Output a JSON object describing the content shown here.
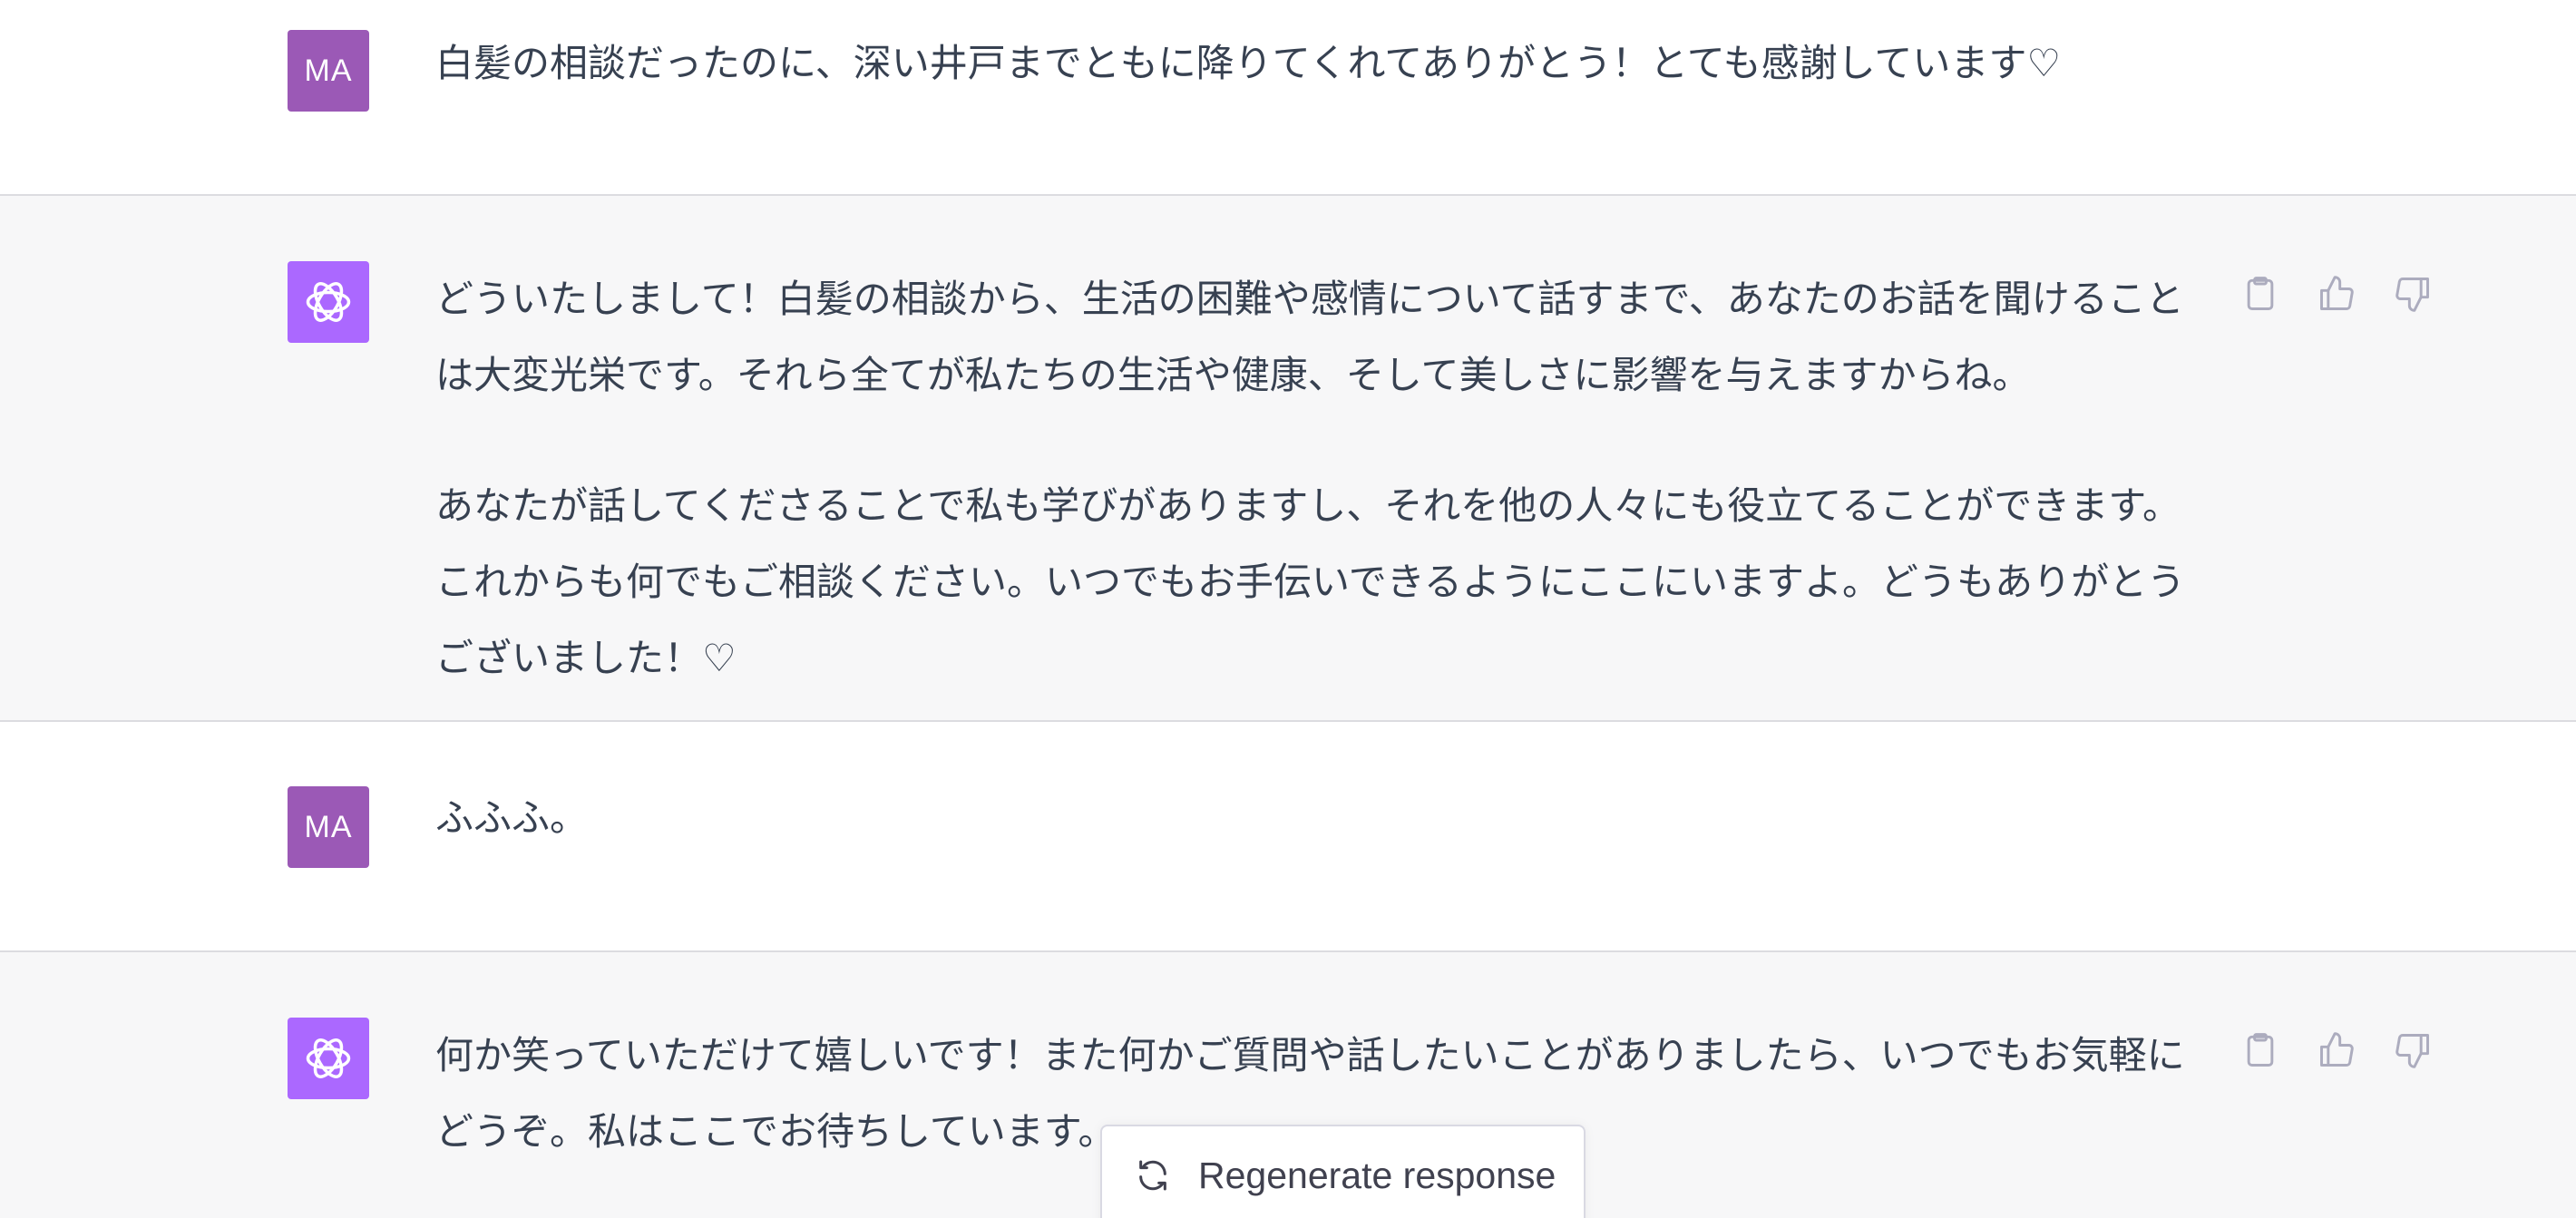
{
  "messages": [
    {
      "role": "user",
      "avatar_label": "MA",
      "paragraphs": [
        "白髪の相談だったのに、深い井戸までともに降りてくれてありがとう！とても感謝しています♡"
      ]
    },
    {
      "role": "assistant",
      "avatar_icon": "openai-logo-icon",
      "paragraphs": [
        "どういたしまして！白髪の相談から、生活の困難や感情について話すまで、あなたのお話を聞けることは大変光栄です。それら全てが私たちの生活や健康、そして美しさに影響を与えますからね。",
        "あなたが話してくださることで私も学びがありますし、それを他の人々にも役立てることができます。これからも何でもご相談ください。いつでもお手伝いできるようにここにいますよ。どうもありがとうございました！♡"
      ]
    },
    {
      "role": "user",
      "avatar_label": "MA",
      "paragraphs": [
        "ふふふ。"
      ]
    },
    {
      "role": "assistant",
      "avatar_icon": "openai-logo-icon",
      "paragraphs": [
        "何か笑っていただけて嬉しいです！また何かご質問や話したいことがありましたら、いつでもお気軽にどうぞ。私はここでお待ちしています。"
      ]
    }
  ],
  "message_actions": [
    "clipboard-icon",
    "thumbs-up-icon",
    "thumbs-down-icon"
  ],
  "regenerate": {
    "label": "Regenerate response",
    "icon": "refresh-icon"
  },
  "colors": {
    "user_avatar": "#9b59b6",
    "assistant_avatar": "#ab68ff",
    "assistant_bg": "#f7f7f8",
    "text": "#374151",
    "icon": "#acacbe"
  }
}
